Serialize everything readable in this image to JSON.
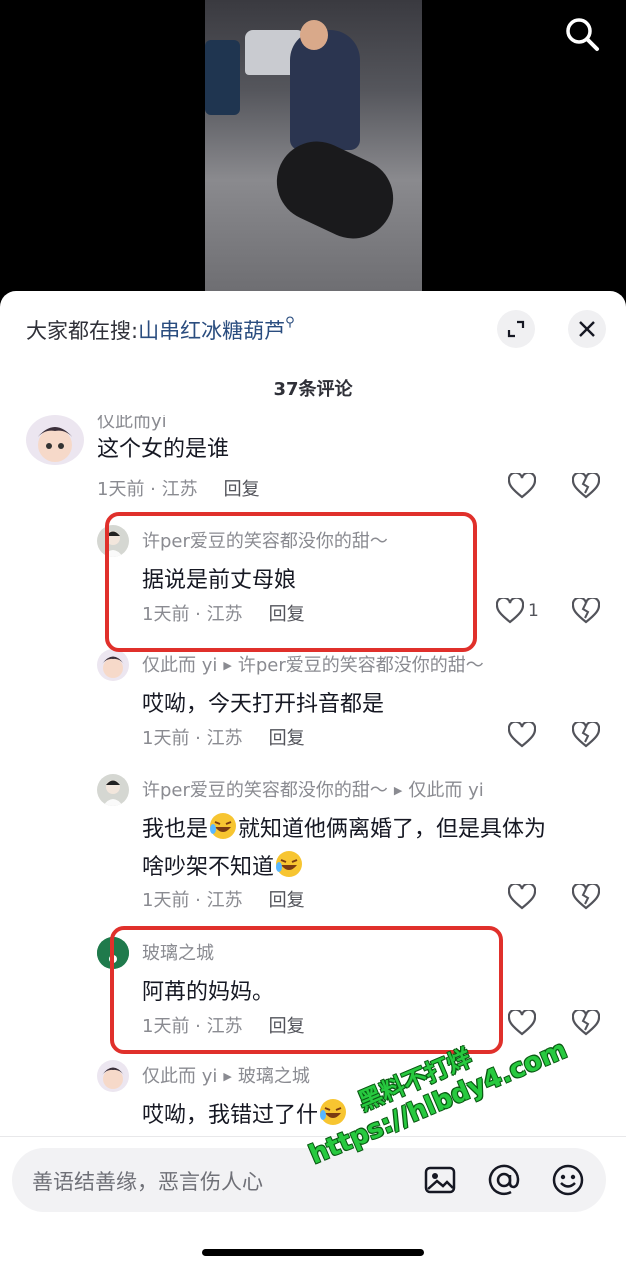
{
  "search": {
    "prefix": "大家都在搜:",
    "keyword": "山串红冰糖葫芦"
  },
  "comment_count": "37条评论",
  "comments": [
    {
      "user": "仅此而yi",
      "text": "这个女的是谁",
      "time_loc": "1天前 · 江苏",
      "reply": "回复",
      "likes": ""
    },
    {
      "user": "许per爱豆的笑容都没你的甜～",
      "text": "据说是前丈母娘",
      "time_loc": "1天前 · 江苏",
      "reply": "回复",
      "likes": "1"
    },
    {
      "user": "仅此而 yi",
      "reply_to": "许per爱豆的笑容都没你的甜～",
      "text": "哎呦，今天打开抖音都是",
      "time_loc": "1天前 · 江苏",
      "reply": "回复",
      "likes": ""
    },
    {
      "user": "许per爱豆的笑容都没你的甜～",
      "reply_to": "仅此而 yi",
      "text_a": "我也是",
      "text_b": "就知道他俩离婚了，但是具体为",
      "text_c": "啥吵架不知道",
      "time_loc": "1天前 · 江苏",
      "reply": "回复",
      "likes": ""
    },
    {
      "user": "玻璃之城",
      "text": "阿苒的妈妈。",
      "time_loc": "1天前 · 江苏",
      "reply": "回复",
      "likes": ""
    },
    {
      "user": "仅此而 yi",
      "reply_to": "玻璃之城",
      "text": "哎呦，我错过了什",
      "likes": ""
    }
  ],
  "input": {
    "placeholder": "善语结善缘，恶言伤人心"
  },
  "watermark": {
    "line1": "黑料不打烊",
    "line2": "https://hlbdy4.com"
  },
  "colors": {
    "highlight_box": "#e0302b",
    "keyword": "#2a4d7f",
    "watermark": "#27c93f"
  }
}
